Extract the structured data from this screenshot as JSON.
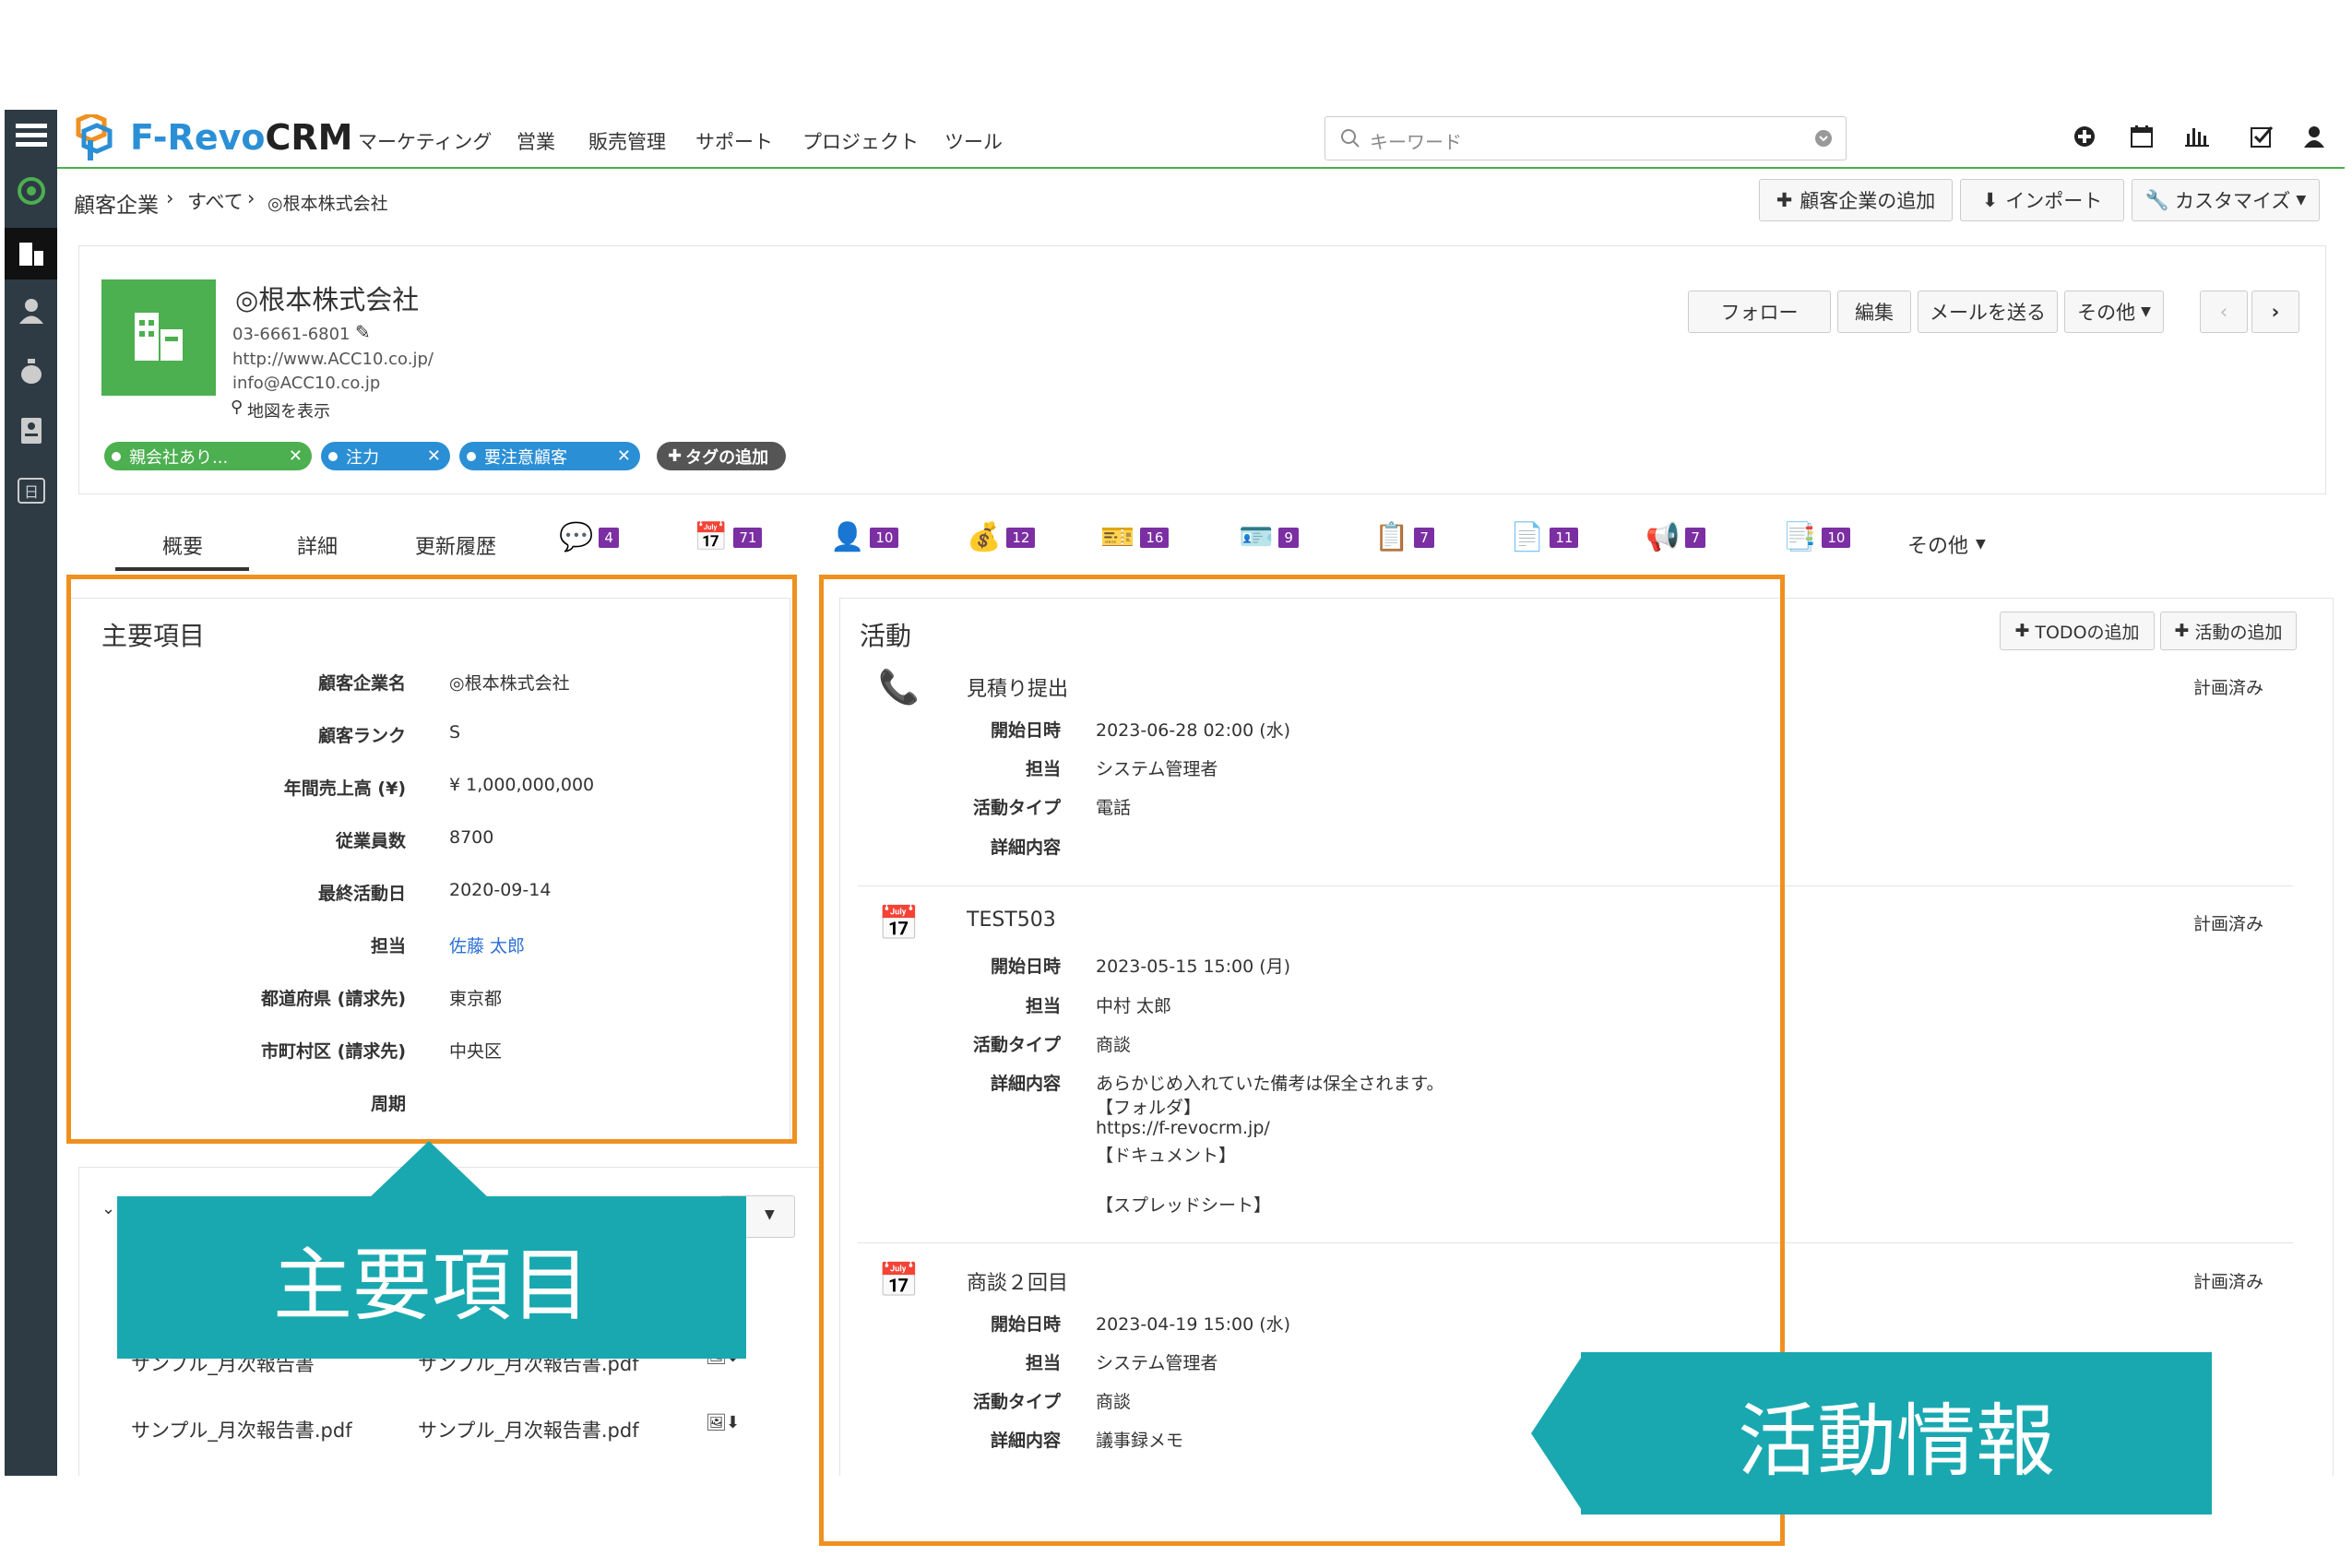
{
  "app": {
    "name_part1": "F-Revo",
    "name_part2": "CRM"
  },
  "nav": {
    "items": [
      "マーケティング",
      "営業",
      "販売管理",
      "サポート",
      "プロジェクト",
      "ツール"
    ]
  },
  "search": {
    "placeholder": "キーワード"
  },
  "breadcrumb": {
    "module": "顧客企業",
    "sep": "›",
    "view": "すべて",
    "record": "◎根本株式会社"
  },
  "toolbar": {
    "add": "顧客企業の追加",
    "import": "インポート",
    "customize": "カスタマイズ"
  },
  "record": {
    "name": "◎根本株式会社",
    "phone": "03-6661-6801",
    "website": "http://www.ACC10.co.jp/",
    "email": "info@ACC10.co.jp",
    "map_link": "地図を表示"
  },
  "actions": {
    "follow": "フォロー",
    "edit": "編集",
    "send_mail": "メールを送る",
    "more": "その他"
  },
  "tags": [
    {
      "label": "親会社あり...",
      "color": "#4caf50"
    },
    {
      "label": "注力",
      "color": "#2b8fd6"
    },
    {
      "label": "要注意顧客",
      "color": "#2b8fd6"
    }
  ],
  "add_tag": "タグの追加",
  "tabs": {
    "summary": "概要",
    "detail": "詳細",
    "history": "更新履歴",
    "counts": [
      "4",
      "71",
      "10",
      "12",
      "16",
      "9",
      "7",
      "11",
      "7",
      "10"
    ],
    "more": "その他"
  },
  "key_fields": {
    "title": "主要項目",
    "fields": [
      {
        "label": "顧客企業名",
        "value": "◎根本株式会社"
      },
      {
        "label": "顧客ランク",
        "value": "S"
      },
      {
        "label": "年間売上高 (¥)",
        "value": "¥ 1,000,000,000"
      },
      {
        "label": "従業員数",
        "value": "8700"
      },
      {
        "label": "最終活動日",
        "value": "2020-09-14"
      },
      {
        "label": "担当",
        "value": "佐藤 太郎"
      },
      {
        "label": "都道府県 (請求先)",
        "value": "東京都"
      },
      {
        "label": "市町村区 (請求先)",
        "value": "中央区"
      },
      {
        "label": "周期",
        "value": ""
      }
    ]
  },
  "documents": {
    "rows": [
      {
        "title": "サンプル_月次報告書",
        "file": "サンプル_月次報告書.pdf"
      },
      {
        "title": "サンプル_月次報告書.pdf",
        "file": "サンプル_月次報告書.pdf"
      }
    ]
  },
  "activities": {
    "title": "活動",
    "add_todo": "TODOの追加",
    "add_activity": "活動の追加",
    "labels": {
      "start": "開始日時",
      "owner": "担当",
      "type": "活動タイプ",
      "detail": "詳細内容"
    },
    "items": [
      {
        "title": "見積り提出",
        "status": "計画済み",
        "start": "2023-06-28 02:00 (水)",
        "owner": "システム管理者",
        "type": "電話",
        "detail": []
      },
      {
        "title": "TEST503",
        "status": "計画済み",
        "start": "2023-05-15 15:00 (月)",
        "owner": "中村 太郎",
        "type": "商談",
        "detail": [
          "あらかじめ入れていた備考は保全されます。",
          "【フォルダ】",
          "https://f-revocrm.jp/",
          "【ドキュメント】",
          "",
          "【スプレッドシート】"
        ]
      },
      {
        "title": "商談２回目",
        "status": "計画済み",
        "start": "2023-04-19 15:00 (水)",
        "owner": "システム管理者",
        "type": "商談",
        "detail": [
          "議事録メモ"
        ]
      }
    ]
  },
  "callouts": {
    "key": "主要項目",
    "activity": "活動情報"
  },
  "colors": {
    "accent": "#4caf50",
    "callout": "#19a8b0",
    "highlight": "#f0901e",
    "sidebar": "#2e3b45",
    "badge": "#7b2fa3"
  }
}
